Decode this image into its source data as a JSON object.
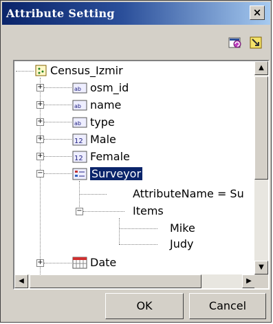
{
  "window": {
    "title": "Attribute Setting",
    "close_label": "×"
  },
  "toolbar": {
    "icons": [
      "refresh-icon",
      "export-icon"
    ]
  },
  "tree": {
    "root": "Census_Izmir",
    "nodes": [
      {
        "label": "osm_id",
        "icon": "text-field-icon",
        "expander": "+"
      },
      {
        "label": "name",
        "icon": "text-field-icon",
        "expander": "+"
      },
      {
        "label": "type",
        "icon": "text-field-icon",
        "expander": "+"
      },
      {
        "label": "Male",
        "icon": "numeric-field-icon",
        "expander": "+"
      },
      {
        "label": "Female",
        "icon": "numeric-field-icon",
        "expander": "+"
      },
      {
        "label": "Surveyor",
        "icon": "list-field-icon",
        "expander": "−",
        "selected": true
      },
      {
        "label": "Date",
        "icon": "date-field-icon",
        "expander": "+"
      }
    ],
    "surveyor_children": {
      "attribute_name": "AttributeName = Su",
      "items_label": "Items",
      "items_expander": "−",
      "items": [
        "Mike",
        "Judy"
      ]
    }
  },
  "buttons": {
    "ok": "OK",
    "cancel": "Cancel"
  },
  "colors": {
    "title_start": "#0a246a",
    "title_end": "#a6caf0",
    "selection": "#0a246a",
    "face": "#d4d0c8"
  }
}
